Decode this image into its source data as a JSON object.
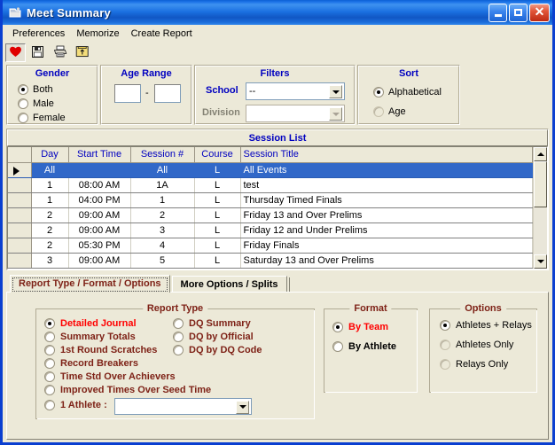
{
  "window": {
    "title": "Meet Summary",
    "icon": "app-window-icon",
    "buttons": {
      "minimize": "minimize",
      "maximize": "maximize",
      "close": "close"
    }
  },
  "menubar": {
    "items": [
      {
        "label": "Preferences"
      },
      {
        "label": "Memorize"
      },
      {
        "label": "Create Report"
      }
    ]
  },
  "toolbar": {
    "buttons": [
      {
        "icon": "heart-icon",
        "pressed": true
      },
      {
        "icon": "save-floppy-icon",
        "pressed": false
      },
      {
        "icon": "printer-icon",
        "pressed": false
      },
      {
        "icon": "folder-export-icon",
        "pressed": false
      }
    ]
  },
  "gender": {
    "title": "Gender",
    "options": [
      {
        "label": "Both",
        "selected": true
      },
      {
        "label": "Male",
        "selected": false
      },
      {
        "label": "Female",
        "selected": false
      }
    ]
  },
  "age_range": {
    "title": "Age Range",
    "low_value": "",
    "high_value": "",
    "separator": "-"
  },
  "filters": {
    "title": "Filters",
    "school": {
      "label": "School",
      "value": "--",
      "enabled": true
    },
    "division": {
      "label": "Division",
      "value": "",
      "enabled": false
    }
  },
  "sort": {
    "title": "Sort",
    "options": [
      {
        "label": "Alphabetical",
        "selected": true
      },
      {
        "label": "Age",
        "selected": false
      }
    ]
  },
  "session_list": {
    "title": "Session List",
    "columns": [
      "",
      "Day",
      "Start Time",
      "Session #",
      "Course",
      "Session Title"
    ],
    "rows": [
      {
        "marker": true,
        "selected": true,
        "day": "All",
        "start_time": "",
        "session_no": "All",
        "course": "L",
        "title": "All Events"
      },
      {
        "marker": false,
        "selected": false,
        "day": "1",
        "start_time": "08:00 AM",
        "session_no": "1A",
        "course": "L",
        "title": "test"
      },
      {
        "marker": false,
        "selected": false,
        "day": "1",
        "start_time": "04:00 PM",
        "session_no": "1",
        "course": "L",
        "title": "Thursday Timed Finals"
      },
      {
        "marker": false,
        "selected": false,
        "day": "2",
        "start_time": "09:00 AM",
        "session_no": "2",
        "course": "L",
        "title": "Friday 13 and Over Prelims"
      },
      {
        "marker": false,
        "selected": false,
        "day": "2",
        "start_time": "09:00 AM",
        "session_no": "3",
        "course": "L",
        "title": "Friday 12 and Under Prelims"
      },
      {
        "marker": false,
        "selected": false,
        "day": "2",
        "start_time": "05:30 PM",
        "session_no": "4",
        "course": "L",
        "title": "Friday Finals"
      },
      {
        "marker": false,
        "selected": false,
        "day": "3",
        "start_time": "09:00 AM",
        "session_no": "5",
        "course": "L",
        "title": "Saturday 13 and Over Prelims"
      }
    ],
    "scrollbar": {
      "up": "scroll-up-icon",
      "down": "scroll-down-icon"
    }
  },
  "tabs": [
    {
      "label": "Report Type / Format / Options",
      "active": true
    },
    {
      "label": "More Options / Splits",
      "active": false
    }
  ],
  "report_type": {
    "title": "Report Type",
    "left_options": [
      {
        "label": "Detailed Journal",
        "selected": true
      },
      {
        "label": "Summary Totals",
        "selected": false
      },
      {
        "label": "1st Round Scratches",
        "selected": false
      },
      {
        "label": "Record Breakers",
        "selected": false
      },
      {
        "label": "Time Std Over Achievers",
        "selected": false
      },
      {
        "label": "Improved Times Over Seed Time",
        "selected": false
      }
    ],
    "right_options": [
      {
        "label": "DQ Summary",
        "selected": false
      },
      {
        "label": "DQ by Official",
        "selected": false
      },
      {
        "label": "DQ by DQ Code",
        "selected": false
      }
    ],
    "athlete_option": {
      "label": "1 Athlete :",
      "selected": false,
      "value": ""
    }
  },
  "format": {
    "title": "Format",
    "options": [
      {
        "label": "By Team",
        "selected": true
      },
      {
        "label": "By Athlete",
        "selected": false
      }
    ]
  },
  "options": {
    "title": "Options",
    "items": [
      {
        "label": "Athletes + Relays",
        "selected": true
      },
      {
        "label": "Athletes Only",
        "selected": false
      },
      {
        "label": "Relays Only",
        "selected": false
      }
    ]
  },
  "colors": {
    "accent_blue": "#0a3fd0",
    "panel_face": "#ece9d8",
    "label_blue": "#0000c0",
    "maroon": "#7e2217",
    "selected_red": "#ff0000",
    "grid_select": "#3168c8"
  }
}
